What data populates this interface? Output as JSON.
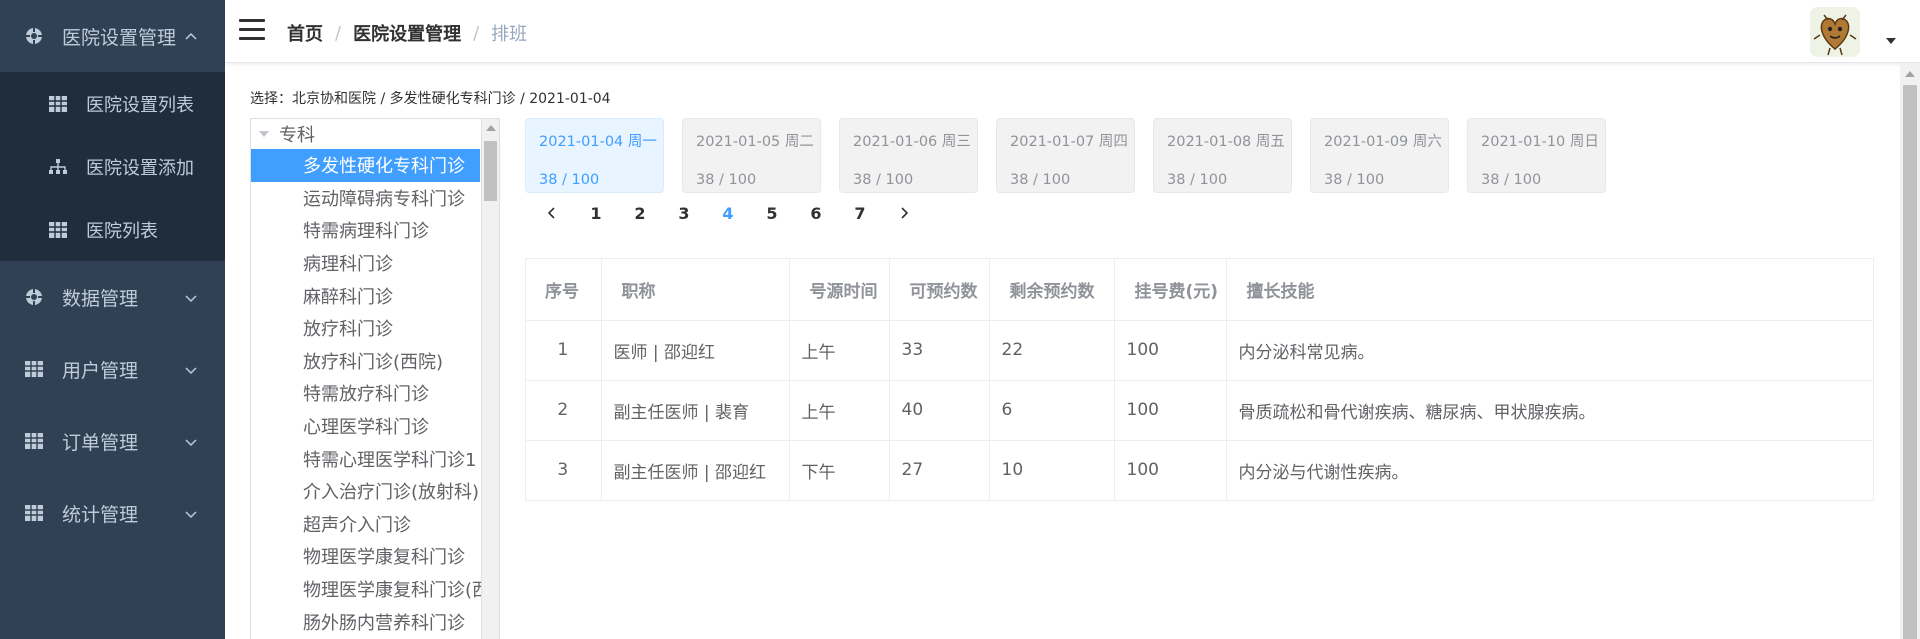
{
  "sidebar": {
    "groups": [
      {
        "label": "医院设置管理",
        "open": true,
        "icon": "settings-icon",
        "items": [
          {
            "label": "医院设置列表",
            "icon": "grid-table-icon"
          },
          {
            "label": "医院设置添加",
            "icon": "sitemap-icon"
          },
          {
            "label": "医院列表",
            "icon": "grid-table-icon"
          }
        ]
      },
      {
        "label": "数据管理",
        "open": false,
        "icon": "settings-icon"
      },
      {
        "label": "用户管理",
        "open": false,
        "icon": "grid-table-icon"
      },
      {
        "label": "订单管理",
        "open": false,
        "icon": "grid-table-icon"
      },
      {
        "label": "统计管理",
        "open": false,
        "icon": "grid-table-icon"
      }
    ]
  },
  "header": {
    "breadcrumb": [
      "首页",
      "医院设置管理",
      "排班"
    ],
    "separator": "/",
    "avatar_icon": "avatar-icon"
  },
  "selection": {
    "text": "选择：北京协和医院 / 多发性硬化专科门诊 / 2021-01-04"
  },
  "tree": {
    "root": "专科",
    "nodes": [
      "多发性硬化专科门诊",
      "运动障碍病专科门诊",
      "特需病理科门诊",
      "病理科门诊",
      "麻醉科门诊",
      "放疗科门诊",
      "放疗科门诊(西院)",
      "特需放疗科门诊",
      "心理医学科门诊",
      "特需心理医学科门诊1",
      "介入治疗门诊(放射科)",
      "超声介入门诊",
      "物理医学康复科门诊",
      "物理医学康复科门诊(西",
      "肠外肠内营养科门诊"
    ],
    "active_index": 0
  },
  "dates": [
    {
      "date": "2021-01-04 周一",
      "count": "38 / 100",
      "active": true
    },
    {
      "date": "2021-01-05 周二",
      "count": "38 / 100",
      "active": false
    },
    {
      "date": "2021-01-06 周三",
      "count": "38 / 100",
      "active": false
    },
    {
      "date": "2021-01-07 周四",
      "count": "38 / 100",
      "active": false
    },
    {
      "date": "2021-01-08 周五",
      "count": "38 / 100",
      "active": false
    },
    {
      "date": "2021-01-09 周六",
      "count": "38 / 100",
      "active": false
    },
    {
      "date": "2021-01-10 周日",
      "count": "38 / 100",
      "active": false
    }
  ],
  "pager": {
    "pages": [
      "1",
      "2",
      "3",
      "4",
      "5",
      "6",
      "7"
    ],
    "current": "4"
  },
  "table": {
    "headers": [
      "序号",
      "职称",
      "号源时间",
      "可预约数",
      "剩余预约数",
      "挂号费(元)",
      "擅长技能"
    ],
    "rows": [
      [
        "1",
        "医师 | 邵迎红",
        "上午",
        "33",
        "22",
        "100",
        "内分泌科常见病。"
      ],
      [
        "2",
        "副主任医师 | 裴育",
        "上午",
        "40",
        "6",
        "100",
        "骨质疏松和骨代谢疾病、糖尿病、甲状腺疾病。"
      ],
      [
        "3",
        "副主任医师 | 邵迎红",
        "下午",
        "27",
        "10",
        "100",
        "内分泌与代谢性疾病。"
      ]
    ]
  },
  "colors": {
    "sidebar_bg": "#304156",
    "submenu_bg": "#1f2d3d",
    "accent": "#409eff"
  }
}
